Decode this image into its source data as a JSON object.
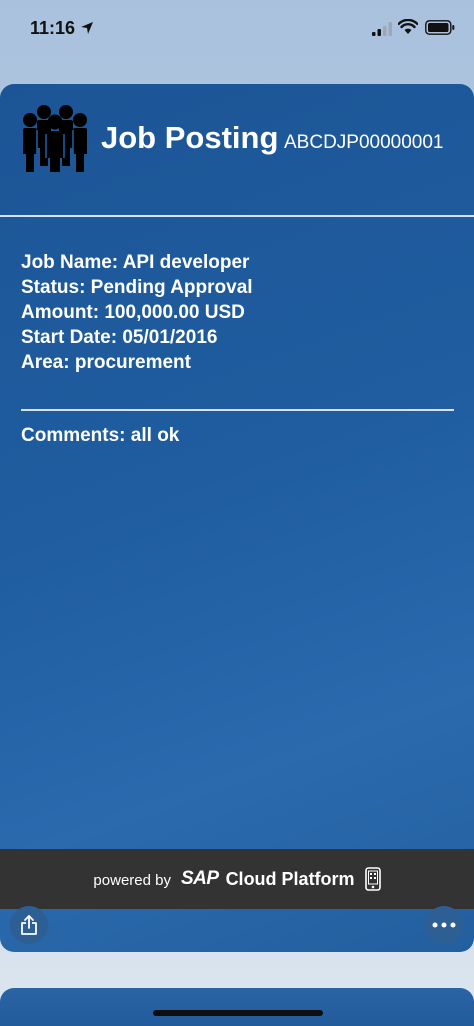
{
  "status_bar": {
    "time": "11:16"
  },
  "card": {
    "title": "Job Posting",
    "job_id": "ABCDJP00000001",
    "details": [
      "Job Name: API developer",
      "Status: Pending Approval",
      "Amount: 100,000.00 USD",
      "Start Date: 05/01/2016",
      "Area: procurement"
    ],
    "comments": "Comments: all ok",
    "icon": "people-group-icon"
  },
  "footer": {
    "powered_by": "powered by",
    "brand": "SAP",
    "product": "Cloud Platform",
    "icon": "mobile-device-icon"
  },
  "actions": {
    "share_icon": "share-icon",
    "more_icon": "more-icon"
  },
  "colors": {
    "card_blue": "#1f5da0",
    "footer_dark": "#333333",
    "text": "#ffffff"
  }
}
